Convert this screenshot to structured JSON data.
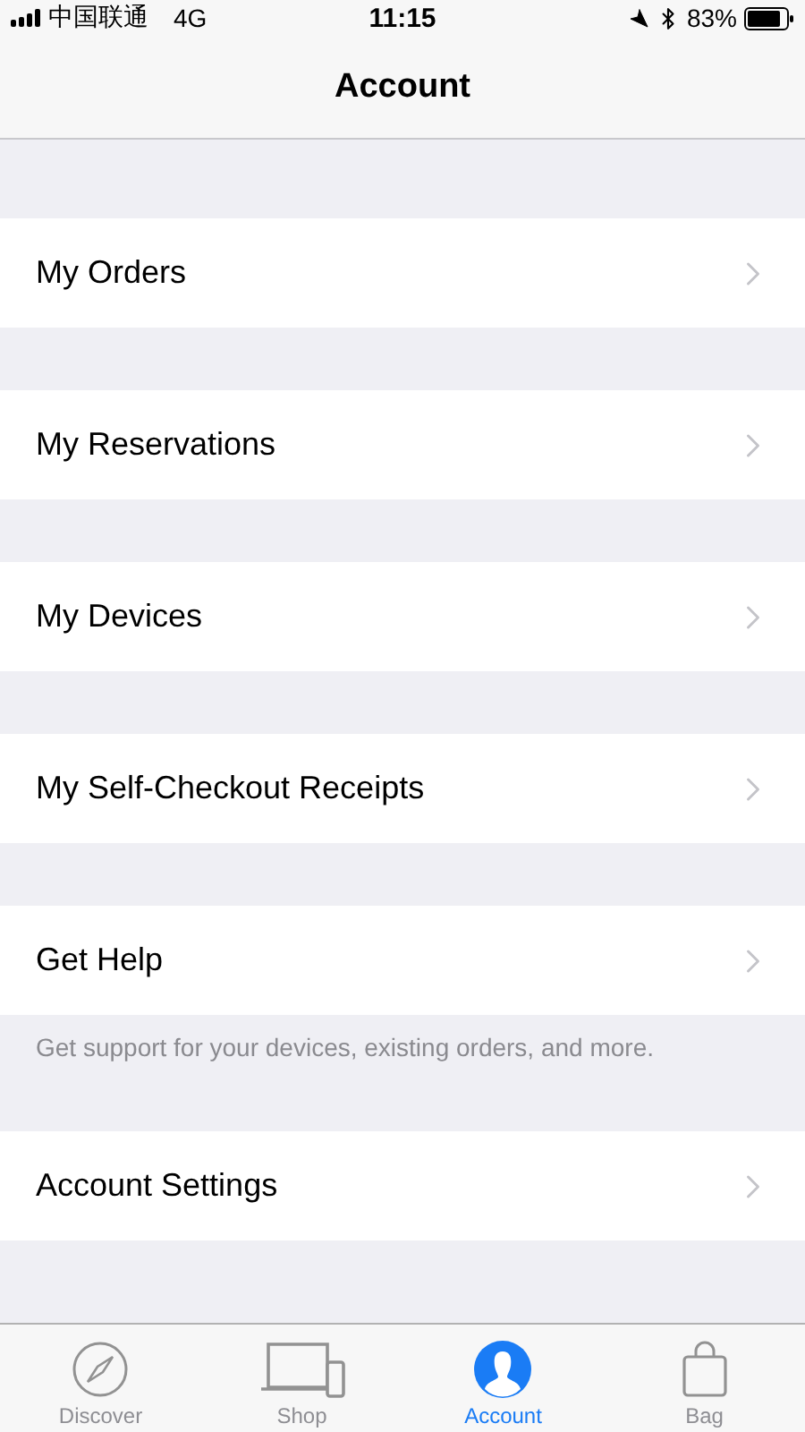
{
  "status_bar": {
    "carrier": "中国联通",
    "network": "4G",
    "time": "11:15",
    "battery": "83%"
  },
  "nav": {
    "title": "Account"
  },
  "rows": [
    {
      "label": "My Orders"
    },
    {
      "label": "My Reservations"
    },
    {
      "label": "My Devices"
    },
    {
      "label": "My Self-Checkout Receipts"
    },
    {
      "label": "Get Help",
      "footer": "Get support for your devices, existing orders, and more."
    },
    {
      "label": "Account Settings"
    }
  ],
  "tab_bar": [
    {
      "kind": "compass",
      "label": "Discover",
      "selected": false
    },
    {
      "kind": "devices",
      "label": "Shop",
      "selected": false
    },
    {
      "kind": "person",
      "label": "Account",
      "selected": true
    },
    {
      "kind": "bag",
      "label": "Bag",
      "selected": false
    }
  ]
}
